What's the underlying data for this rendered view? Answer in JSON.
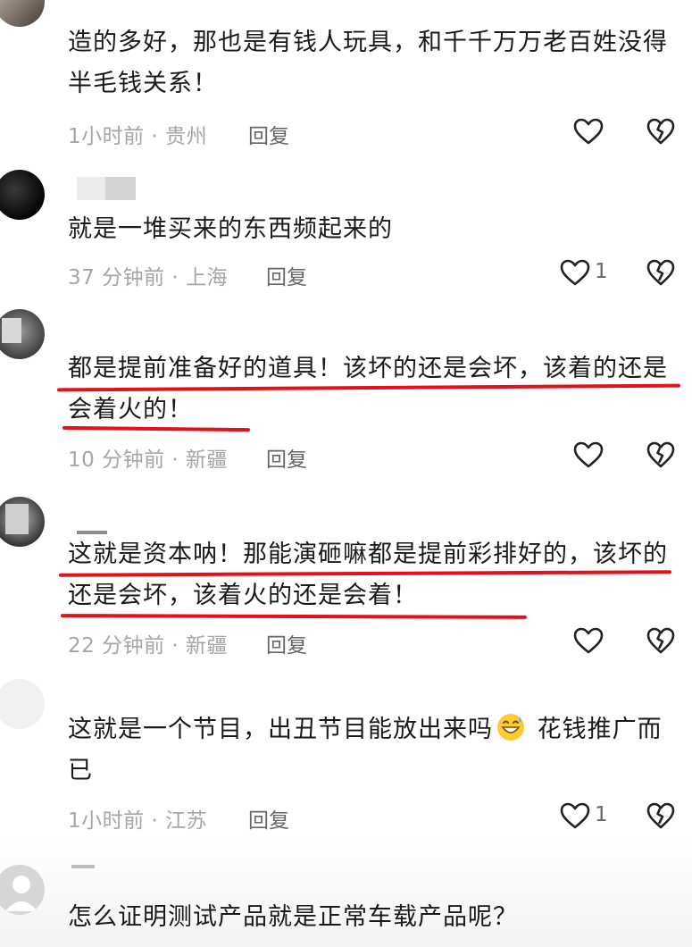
{
  "comments": [
    {
      "text": "造的多好，那也是有钱人玩具，和千千万万老百姓没得半毛钱关系！",
      "meta": "1小时前 · 贵州",
      "reply": "回复",
      "likes": ""
    },
    {
      "text": "就是一堆买来的东西频起来的",
      "meta": "37 分钟前 · 上海",
      "reply": "回复",
      "likes": "1"
    },
    {
      "text": "都是提前准备好的道具！该坏的还是会坏，该着的还是会着火的！",
      "meta": "10 分钟前 · 新疆",
      "reply": "回复",
      "likes": ""
    },
    {
      "text": "这就是资本呐！那能演砸嘛都是提前彩排好的，该坏的还是会坏，该着火的还是会着！",
      "meta": "22 分钟前 · 新疆",
      "reply": "回复",
      "likes": ""
    },
    {
      "text_before": "这就是一个节目，出丑节目能放出来吗",
      "emoji": "grinning-sweat-emoji",
      "text_after": " 花钱推广而已",
      "meta": "1小时前 · 江苏",
      "reply": "回复",
      "likes": "1"
    },
    {
      "text": "怎么证明测试产品就是正常车载产品呢？"
    }
  ],
  "colors": {
    "underline": "#e0121b",
    "meta": "#a6a6a6",
    "text": "#1a1a1a"
  },
  "icons": {
    "like": "heart-outline-icon",
    "dislike": "broken-heart-icon"
  }
}
